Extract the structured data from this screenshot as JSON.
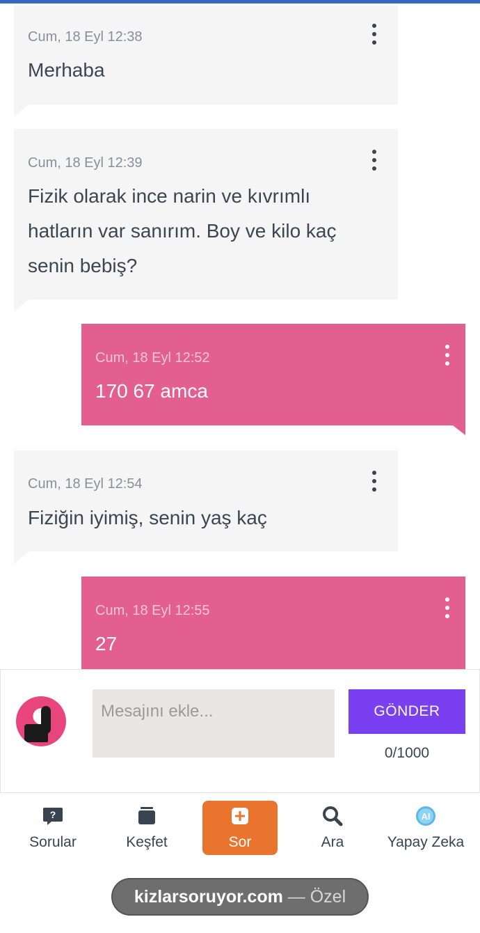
{
  "messages": [
    {
      "timestamp": "Cum, 18 Eyl 12:38",
      "text": "Merhaba",
      "direction": "incoming"
    },
    {
      "timestamp": "Cum, 18 Eyl 12:39",
      "text": "Fizik olarak ince narin ve kıvrımlı hatların var sanırım. Boy ve kilo kaç senin bebiş?",
      "direction": "incoming"
    },
    {
      "timestamp": "Cum, 18 Eyl 12:52",
      "text": "170 67 amca",
      "direction": "outgoing"
    },
    {
      "timestamp": "Cum, 18 Eyl 12:54",
      "text": "Fiziğin iyimiş, senin yaş kaç",
      "direction": "incoming"
    },
    {
      "timestamp": "Cum, 18 Eyl 12:55",
      "text": "27",
      "direction": "outgoing"
    }
  ],
  "composer": {
    "placeholder": "Mesajını ekle...",
    "send_label": "GÖNDER",
    "counter": "0/1000"
  },
  "tabbar": {
    "items": [
      {
        "label": "Sorular",
        "icon": "question-bubble-icon"
      },
      {
        "label": "Keşfet",
        "icon": "stack-icon"
      },
      {
        "label": "Sor",
        "icon": "plus-icon",
        "active": true
      },
      {
        "label": "Ara",
        "icon": "search-icon"
      },
      {
        "label": "Yapay Zeka",
        "icon": "ai-icon"
      }
    ]
  },
  "footer": {
    "domain": "kizlarsoruyor.com",
    "separator": "—",
    "suffix": "Özel"
  },
  "colors": {
    "accent_bar": "#3566c0",
    "incoming_bubble": "#f5f5f5",
    "outgoing_bubble": "#e35f8f",
    "send_button": "#7b3ff2",
    "active_tab": "#e9742e"
  }
}
